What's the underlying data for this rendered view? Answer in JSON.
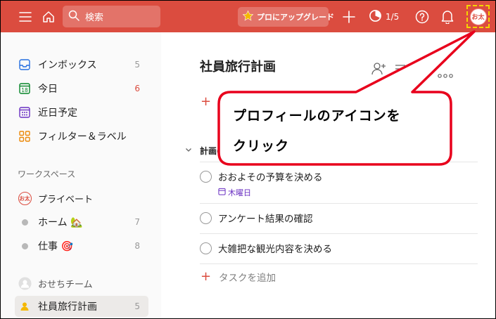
{
  "topbar": {
    "search_placeholder": "検索",
    "upgrade_label": "プロにアップグレード",
    "productivity": "1/5",
    "avatar_initials": "お太"
  },
  "sidebar": {
    "items": [
      {
        "label": "インボックス",
        "count": "5"
      },
      {
        "label": "今日",
        "count": "6"
      },
      {
        "label": "近日予定",
        "count": ""
      },
      {
        "label": "フィルター＆ラベル",
        "count": ""
      }
    ],
    "workspace_label": "ワークスペース",
    "private_label": "プライベート",
    "private_avatar": "お太",
    "projects": [
      {
        "label": "ホーム 🏡",
        "count": "7"
      },
      {
        "label": "仕事 🎯",
        "count": "8"
      }
    ],
    "team_label": "おせちチーム",
    "team_projects": [
      {
        "label": "社員旅行計画",
        "count": "5"
      }
    ]
  },
  "main": {
    "title": "社員旅行計画",
    "section_title": "計画の",
    "tasks": [
      {
        "text": "おおよその予算を決める",
        "due": "木曜日"
      },
      {
        "text": "アンケート結果の確認",
        "due": ""
      },
      {
        "text": "大雑把な観光内容を決める",
        "due": ""
      }
    ],
    "add_task_label": "タスクを追加"
  },
  "callout": {
    "line1": "プロフィールのアイコンを",
    "line2": "クリック"
  },
  "colors": {
    "accent": "#db4c3f",
    "callout_border": "#e8001c",
    "highlight": "#f5d400",
    "due": "#692fc2"
  }
}
